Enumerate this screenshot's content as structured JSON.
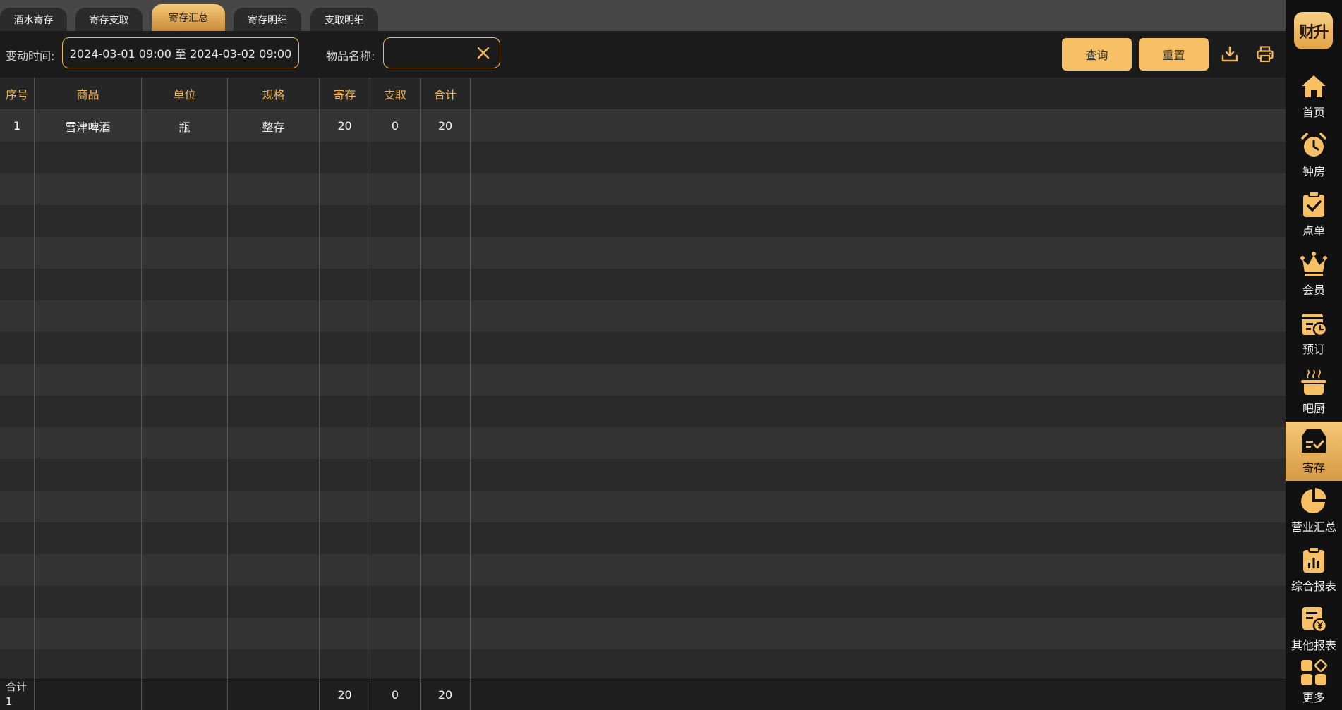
{
  "tabs": [
    {
      "label": "酒水寄存",
      "active": false
    },
    {
      "label": "寄存支取",
      "active": false
    },
    {
      "label": "寄存汇总",
      "active": true
    },
    {
      "label": "寄存明细",
      "active": false
    },
    {
      "label": "支取明细",
      "active": false
    }
  ],
  "filters": {
    "date_label": "变动时间:",
    "date_value": "2024-03-01 09:00 至 2024-03-02 09:00",
    "name_label": "物品名称:",
    "name_value": "",
    "query_label": "查询",
    "reset_label": "重置"
  },
  "table": {
    "columns": [
      "序号",
      "商品",
      "单位",
      "规格",
      "寄存",
      "支取",
      "合计"
    ],
    "rows": [
      [
        "1",
        "雪津啤酒",
        "瓶",
        "整存",
        "20",
        "0",
        "20"
      ]
    ],
    "footer": {
      "label": "合计",
      "count": "1",
      "deposit": "20",
      "withdraw": "0",
      "total": "20"
    }
  },
  "sidebar": {
    "logo_text": "财升",
    "items": [
      {
        "label": "首页",
        "icon": "home-icon"
      },
      {
        "label": "钟房",
        "icon": "alarm-clock-icon"
      },
      {
        "label": "点单",
        "icon": "clipboard-check-icon"
      },
      {
        "label": "会员",
        "icon": "crown-icon"
      },
      {
        "label": "预订",
        "icon": "calendar-clock-icon"
      },
      {
        "label": "吧厨",
        "icon": "cooking-pot-icon"
      },
      {
        "label": "寄存",
        "icon": "storage-box-icon",
        "active": true
      },
      {
        "label": "营业汇总",
        "icon": "pie-chart-icon"
      },
      {
        "label": "综合报表",
        "icon": "bar-report-icon"
      },
      {
        "label": "其他报表",
        "icon": "yuan-report-icon"
      },
      {
        "label": "更多",
        "icon": "apps-grid-icon"
      }
    ]
  },
  "colors": {
    "accent": "#f7c064",
    "background": "#1c1c1c",
    "header_text": "#f0b75a"
  }
}
